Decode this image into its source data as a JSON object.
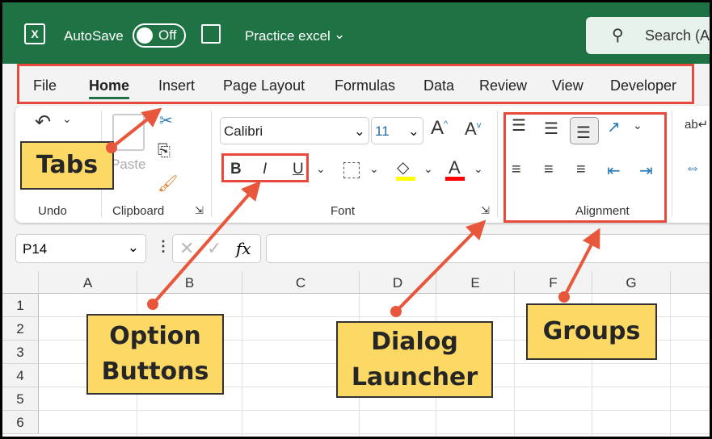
{
  "titlebar": {
    "autosave": "AutoSave",
    "toggle": "Off",
    "filename": "Practice excel",
    "search": "Search (A"
  },
  "tabs": [
    "File",
    "Home",
    "Insert",
    "Page Layout",
    "Formulas",
    "Data",
    "Review",
    "View",
    "Developer"
  ],
  "ribbon": {
    "groups": {
      "undo": "Undo",
      "clipboard": "Clipboard",
      "font": "Font",
      "alignment": "Alignment"
    },
    "paste": "Paste",
    "font_name": "Calibri",
    "font_size": "11",
    "bold": "B",
    "italic": "I",
    "underline": "U",
    "font_color": "A"
  },
  "formula_bar": {
    "name_box": "P14",
    "fx": "fx"
  },
  "grid": {
    "columns": [
      "A",
      "B",
      "C",
      "D",
      "E",
      "F",
      "G"
    ],
    "rows": [
      "1",
      "2",
      "3",
      "4",
      "5",
      "6"
    ]
  },
  "callouts": {
    "tabs": "Tabs",
    "option_buttons": [
      "Option",
      "Buttons"
    ],
    "dialog_launcher": [
      "Dialog",
      "Launcher"
    ],
    "groups": "Groups"
  },
  "colors": {
    "title_green": "#1f7244",
    "annotation_red": "#e8493c",
    "callout_yellow": "#fcd965"
  }
}
